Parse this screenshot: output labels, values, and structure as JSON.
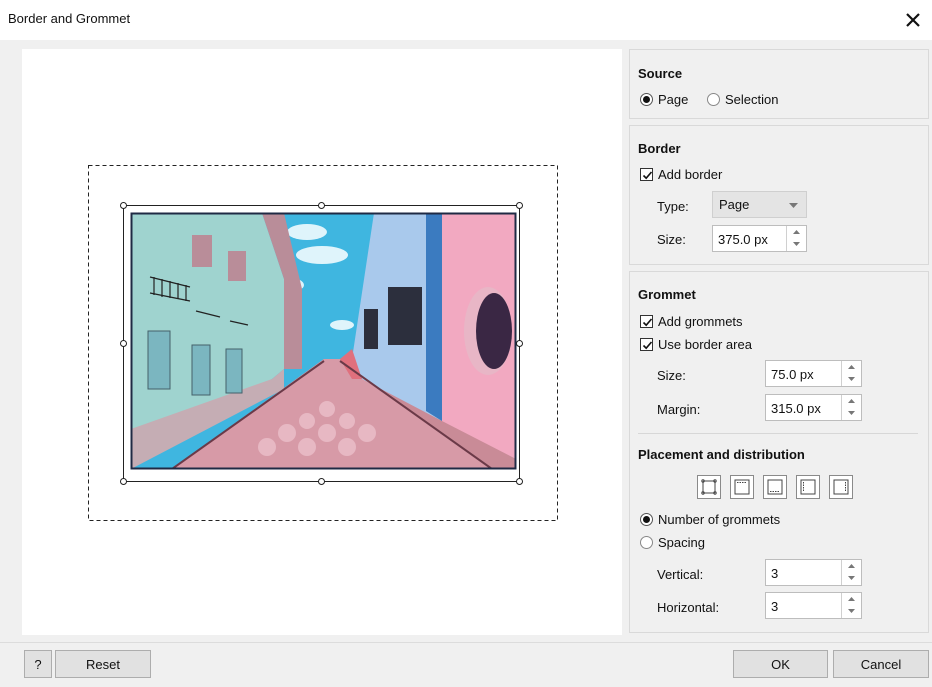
{
  "window": {
    "title": "Border and Grommet"
  },
  "source": {
    "heading": "Source",
    "options": [
      {
        "label": "Page",
        "selected": true
      },
      {
        "label": "Selection",
        "selected": false
      }
    ]
  },
  "border": {
    "heading": "Border",
    "add_border_label": "Add border",
    "add_border_checked": true,
    "type_label": "Type:",
    "type_value": "Page",
    "size_label": "Size:",
    "size_value": "375.0 px"
  },
  "grommet": {
    "heading": "Grommet",
    "add_grommets_label": "Add grommets",
    "add_grommets_checked": true,
    "use_border_area_label": "Use border area",
    "use_border_area_checked": true,
    "size_label": "Size:",
    "size_value": "75.0 px",
    "margin_label": "Margin:",
    "margin_value": "315.0 px"
  },
  "placement": {
    "heading": "Placement and distribution",
    "buttons": [
      "all-sides-icon",
      "top-edge-icon",
      "bottom-edge-icon",
      "left-edge-icon",
      "right-edge-icon"
    ],
    "number_label": "Number of grommets",
    "number_selected": true,
    "spacing_label": "Spacing",
    "spacing_selected": false,
    "vertical_label": "Vertical:",
    "vertical_value": "3",
    "horizontal_label": "Horizontal:",
    "horizontal_value": "3"
  },
  "footer": {
    "help_label": "?",
    "reset_label": "Reset",
    "ok_label": "OK",
    "cancel_label": "Cancel"
  },
  "colors": {
    "sky": "#3fb6e0",
    "street": "#c98b97",
    "left_building": "#9fd3cf",
    "right_building": "#a9c9ec",
    "pink_wall": "#f2a9c1",
    "frame": "#1f2a44"
  }
}
